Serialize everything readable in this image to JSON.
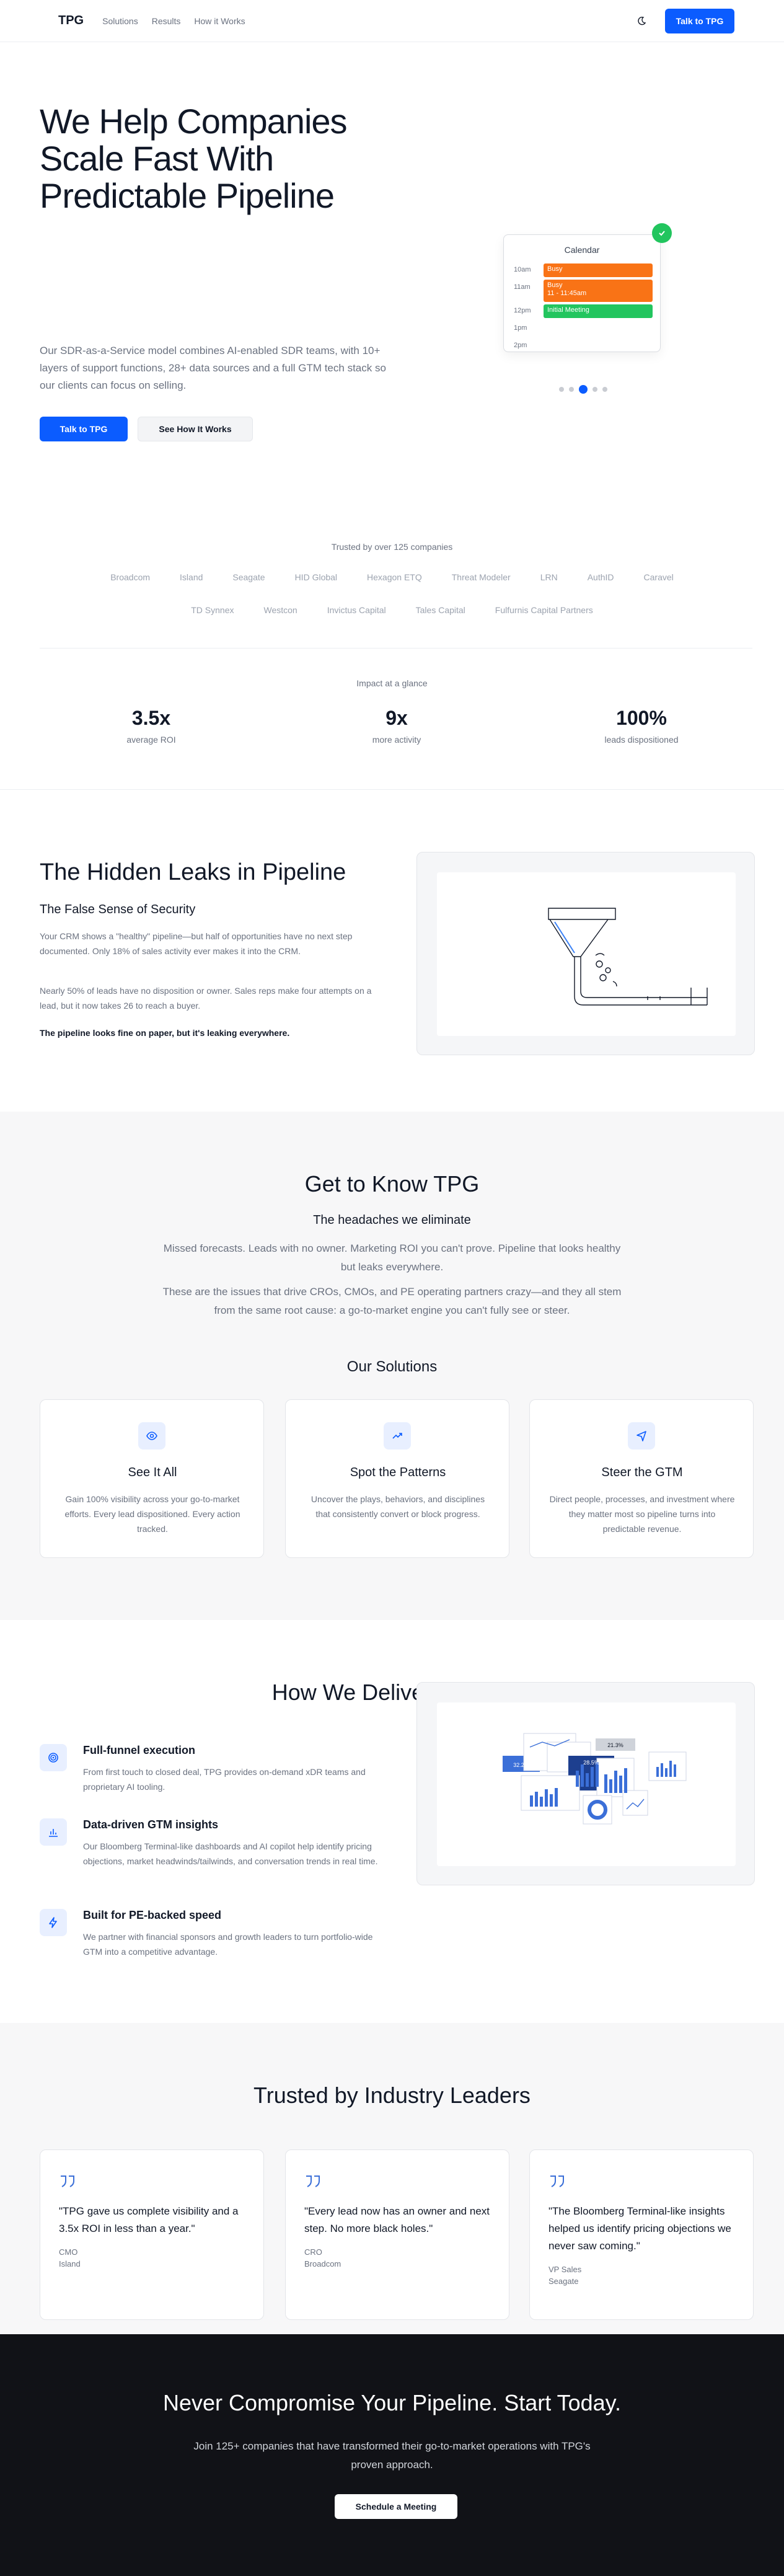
{
  "nav": {
    "logo": "TPG",
    "links": [
      "Solutions",
      "Results",
      "How it Works"
    ],
    "cta": "Talk to TPG"
  },
  "hero": {
    "title": "We Help Companies Scale Fast With Predictable Pipeline",
    "subtitle": "Our SDR-as-a-Service model combines AI-enabled SDR teams, with 10+ layers of support functions, 28+ data sources and a full GTM tech stack so our clients can focus on selling.",
    "primary_button": "Talk to TPG",
    "secondary_button": "See How It Works",
    "calendar": {
      "title": "Calendar",
      "times": [
        "10am",
        "11am",
        "12pm",
        "1pm",
        "2pm"
      ],
      "events": [
        {
          "label": "Busy",
          "time": ""
        },
        {
          "label": "Busy",
          "time": "11 - 11:45am"
        },
        {
          "label": "Initial Meeting",
          "time": ""
        }
      ]
    },
    "colors": {
      "busy": "#f97316",
      "meeting": "#22c55e",
      "accent": "#0b5cff"
    }
  },
  "trusted": {
    "caption": "Trusted by over 125 companies",
    "logos_row1": [
      "Broadcom",
      "Island",
      "Seagate",
      "HID Global",
      "Hexagon ETQ",
      "Threat Modeler",
      "LRN",
      "AuthID",
      "Caravel"
    ],
    "logos_row2": [
      "TD Synnex",
      "Westcon",
      "Invictus Capital",
      "Tales Capital",
      "Fulfurnis Capital Partners"
    ],
    "impact_caption": "Impact at a glance",
    "stats": [
      {
        "value": "3.5x",
        "label": "average ROI"
      },
      {
        "value": "9x",
        "label": "more activity"
      },
      {
        "value": "100%",
        "label": "leads dispositioned"
      }
    ]
  },
  "leaks": {
    "title": "The Hidden Leaks in Pipeline",
    "subtitle": "The False Sense of Security",
    "p1": "Your CRM shows a \"healthy\" pipeline—but half of opportunities have no next step documented. Only 18% of sales activity ever makes it into the CRM.",
    "p2": "Nearly 50% of leads have no disposition or owner. Sales reps make four attempts on a lead, but it now takes 26 to reach a buyer.",
    "p3": "The pipeline looks fine on paper, but it's leaking everywhere."
  },
  "know": {
    "title": "Get to Know TPG",
    "subtitle": "The headaches we eliminate",
    "p1": "Missed forecasts. Leads with no owner. Marketing ROI you can't prove. Pipeline that looks healthy but leaks everywhere.",
    "p2": "These are the issues that drive CROs, CMOs, and PE operating partners crazy—and they all stem from the same root cause: a go-to-market engine you can't fully see or steer.",
    "solutions_title": "Our Solutions",
    "solutions": [
      {
        "icon": "eye-icon",
        "title": "See It All",
        "text": "Gain 100% visibility across your go-to-market efforts. Every lead dispositioned. Every action tracked."
      },
      {
        "icon": "trend-icon",
        "title": "Spot the Patterns",
        "text": "Uncover the plays, behaviors, and disciplines that consistently convert or block progress."
      },
      {
        "icon": "navigation-icon",
        "title": "Steer the GTM",
        "text": "Direct people, processes, and investment where they matter most so pipeline turns into predictable revenue."
      }
    ]
  },
  "deliver": {
    "title": "How We Deliver Results",
    "features": [
      {
        "icon": "target-icon",
        "title": "Full-funnel execution",
        "text": "From first touch to closed deal, TPG provides on-demand xDR teams and proprietary AI tooling."
      },
      {
        "icon": "bar-chart-icon",
        "title": "Data-driven GTM insights",
        "text": "Our Bloomberg Terminal-like dashboards and AI copilot help identify pricing objections, market headwinds/tailwinds, and conversation trends in real time."
      },
      {
        "icon": "bolt-icon",
        "title": "Built for PE-backed speed",
        "text": "We partner with financial sponsors and growth leaders to turn portfolio-wide GTM into a competitive advantage."
      }
    ],
    "dashboard_labels": [
      "32.2%",
      "28.5%",
      "21.3%"
    ]
  },
  "testimonials": {
    "title": "Trusted by Industry Leaders",
    "items": [
      {
        "quote": "\"TPG gave us complete visibility and a 3.5x ROI in less than a year.\"",
        "role": "CMO",
        "company": "Island"
      },
      {
        "quote": "\"Every lead now has an owner and next step. No more black holes.\"",
        "role": "CRO",
        "company": "Broadcom"
      },
      {
        "quote": "\"The Bloomberg Terminal-like insights helped us identify pricing objections we never saw coming.\"",
        "role": "VP Sales",
        "company": "Seagate"
      }
    ]
  },
  "cta": {
    "title": "Never Compromise Your Pipeline. Start Today.",
    "text": "Join 125+ companies that have transformed their go-to-market operations with TPG's proven approach.",
    "button": "Schedule a Meeting"
  }
}
